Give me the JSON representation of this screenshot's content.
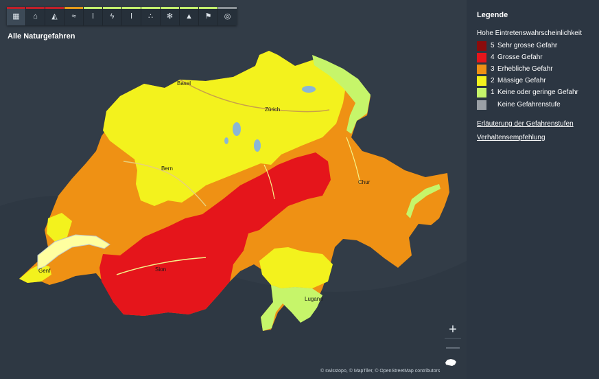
{
  "toolbar": {
    "buttons": [
      {
        "name": "all-hazards",
        "icon": "grid",
        "bar": "#c0202a"
      },
      {
        "name": "flood",
        "icon": "house",
        "bar": "#c0202a"
      },
      {
        "name": "avalanche",
        "icon": "avalanche",
        "bar": "#c0202a"
      },
      {
        "name": "wind",
        "icon": "wind",
        "bar": "#e59a1a"
      },
      {
        "name": "heat",
        "icon": "thermometer",
        "bar": "#c3f06e"
      },
      {
        "name": "thunderstorm",
        "icon": "lightning",
        "bar": "#c3f06e"
      },
      {
        "name": "frost",
        "icon": "thermometer",
        "bar": "#c3f06e"
      },
      {
        "name": "rain",
        "icon": "drops",
        "bar": "#c3f06e"
      },
      {
        "name": "snow",
        "icon": "snowflake",
        "bar": "#c3f06e"
      },
      {
        "name": "landslide",
        "icon": "mountain",
        "bar": "#c3f06e"
      },
      {
        "name": "forest-fire",
        "icon": "fire-flag",
        "bar": "#c3f06e"
      },
      {
        "name": "earthquake",
        "icon": "seismic",
        "bar": "#8c9399"
      }
    ]
  },
  "map": {
    "title": "Alle Naturgefahren",
    "cities": [
      "Basel",
      "Zürich",
      "Bern",
      "Chur",
      "Genf",
      "Sion",
      "Lugano"
    ],
    "attribution": "© swisstopo, © MapTiler, © OpenStreetMap contributors",
    "zoom_in": "+",
    "zoom_out": "—"
  },
  "legend": {
    "title": "Legende",
    "subtitle": "Hohe Eintretenswahrscheinlichkeit",
    "levels": [
      {
        "level": "5",
        "label": "Sehr grosse Gefahr",
        "color": "#8b0c0c"
      },
      {
        "level": "4",
        "label": "Grosse Gefahr",
        "color": "#e5151b"
      },
      {
        "level": "3",
        "label": "Erhebliche Gefahr",
        "color": "#ef9114"
      },
      {
        "level": "2",
        "label": "Mässige Gefahr",
        "color": "#f3f21d"
      },
      {
        "level": "1",
        "label": "Keine oder geringe Gefahr",
        "color": "#c6f56a"
      },
      {
        "level": "",
        "label": "Keine Gefahrenstufe",
        "color": "#9aa0a6"
      }
    ],
    "links": [
      "Erläuterung der Gefahrenstufen",
      "Verhaltensempfehlung"
    ]
  }
}
